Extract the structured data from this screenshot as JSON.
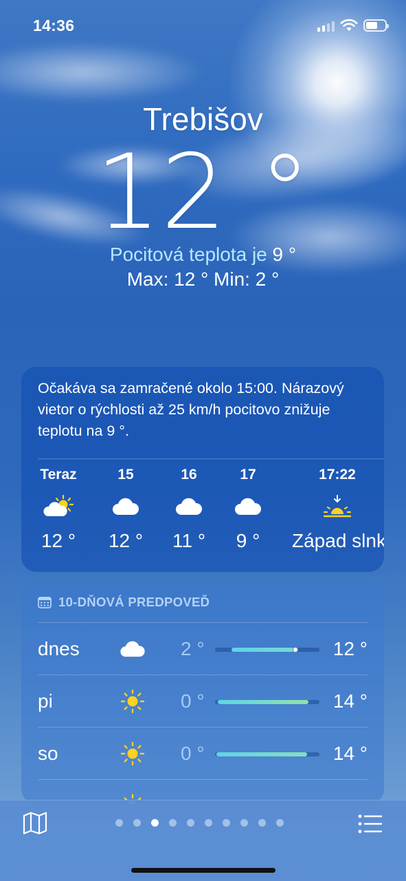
{
  "status": {
    "time": "14:36"
  },
  "header": {
    "city": "Trebišov",
    "temperature": "12 °",
    "feels_like_label": "Pocitová teplota je",
    "feels_like_value": "9 °",
    "max_min": "Max: 12 °  Min: 2 °"
  },
  "hourly": {
    "summary": "Očakáva sa zamračené okolo 15:00. Nárazový vietor o rýchlosti až 25 km/h pocitovo znižuje teplotu na 9 °.",
    "items": [
      {
        "label": "Teraz",
        "icon": "partly-cloudy-icon",
        "temp": "12 °"
      },
      {
        "label": "15",
        "icon": "cloud-icon",
        "temp": "12 °"
      },
      {
        "label": "16",
        "icon": "cloud-icon",
        "temp": "11 °"
      },
      {
        "label": "17",
        "icon": "cloud-icon",
        "temp": "9 °"
      },
      {
        "label": "17:22",
        "icon": "sunset-icon",
        "temp": "Západ slnka"
      }
    ]
  },
  "forecast": {
    "title": "10-DŇOVÁ PREDPOVEĎ",
    "days": [
      {
        "day": "dnes",
        "icon": "cloud-icon",
        "low": "2 °",
        "high": "12 °"
      },
      {
        "day": "pi",
        "icon": "sun-icon",
        "low": "0 °",
        "high": "14 °"
      },
      {
        "day": "so",
        "icon": "sun-icon",
        "low": "0 °",
        "high": "14 °"
      }
    ]
  },
  "pager": {
    "count": 10,
    "active_index": 2
  },
  "colors": {
    "feels_like_accent": "#b9e6ff",
    "sun_yellow": "#ffd21f",
    "bar_start": "#5fd3e8",
    "bar_end": "#8fe3a8"
  }
}
